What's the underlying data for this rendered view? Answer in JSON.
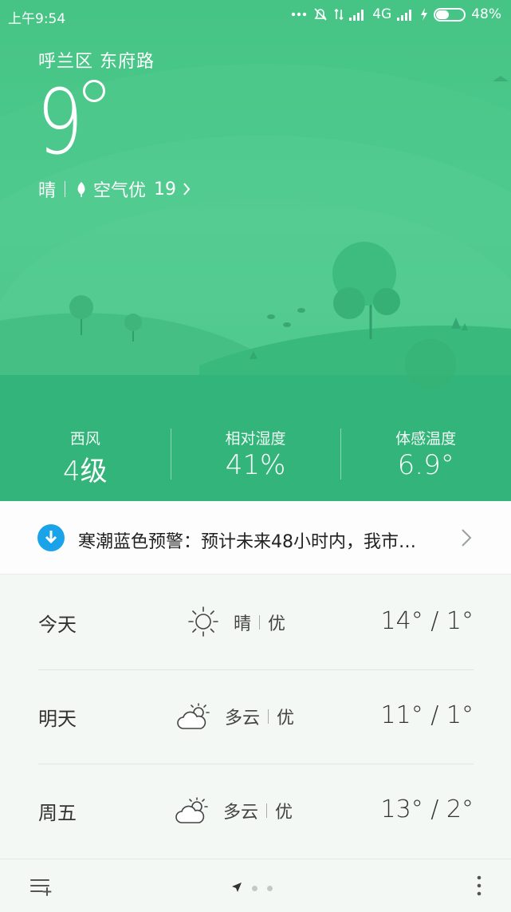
{
  "status_bar": {
    "time": "上午9:54",
    "network": "4G",
    "battery": "48%",
    "battery_level": 0.48
  },
  "current": {
    "location": "呼兰区  东府路",
    "temperature": "9",
    "condition": "晴",
    "air_quality_label": "空气优",
    "air_quality_value": "19"
  },
  "stats": [
    {
      "label": "西风",
      "value": "4级"
    },
    {
      "label": "相对湿度",
      "value": "41%"
    },
    {
      "label": "体感温度",
      "value": "6.9°"
    }
  ],
  "alert": {
    "text": "寒潮蓝色预警：预计未来48小时内，我市…",
    "icon": "download-arrow-icon",
    "color": "#1aa3e8"
  },
  "forecast": [
    {
      "day": "今天",
      "icon": "sunny-icon",
      "condition": "晴",
      "air": "优",
      "temps": "14° / 1°"
    },
    {
      "day": "明天",
      "icon": "partly-cloudy-icon",
      "condition": "多云",
      "air": "优",
      "temps": "11° / 1°"
    },
    {
      "day": "周五",
      "icon": "partly-cloudy-icon",
      "condition": "多云",
      "air": "优",
      "temps": "13° / 2°"
    }
  ],
  "pager": {
    "pages": 3,
    "current": 1
  },
  "colors": {
    "hero_green": "#46c485",
    "stats_green": "#2fb47a",
    "background": "#f3f8f5"
  }
}
